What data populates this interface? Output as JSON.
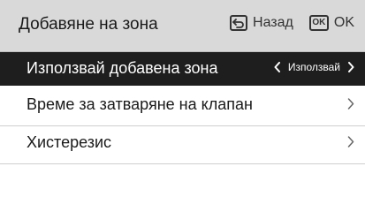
{
  "header": {
    "title": "Добавяне на зона",
    "back_label": "Назад",
    "ok_key": "OK",
    "ok_label": "OK"
  },
  "menu": [
    {
      "label": "Използвай добавена зона",
      "value": "Използвай",
      "selected": true
    },
    {
      "label": "Време за затваряне на клапан"
    },
    {
      "label": "Хистерезис"
    }
  ],
  "colors": {
    "header_bg": "#d9d9d9",
    "selected_bg": "#1e1e1e",
    "selected_text": "#ffffff",
    "divider": "#cfcfcf"
  },
  "icons": {
    "back": "return-arrow-icon",
    "ok": "ok-key-icon",
    "left": "chevron-left-icon",
    "right": "chevron-right-icon"
  }
}
